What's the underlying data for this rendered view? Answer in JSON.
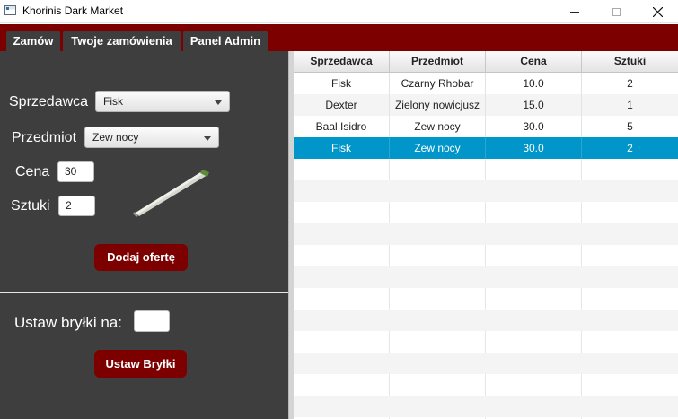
{
  "window": {
    "title": "Khorinis Dark Market"
  },
  "tabs": [
    {
      "label": "Zamów"
    },
    {
      "label": "Twoje zamówienia"
    },
    {
      "label": "Panel Admin"
    }
  ],
  "form": {
    "seller_label": "Sprzedawca",
    "seller_value": "Fisk",
    "item_label": "Przedmiot",
    "item_value": "Zew nocy",
    "price_label": "Cena",
    "price_value": "30",
    "quantity_label": "Sztuki",
    "quantity_value": "2",
    "add_button": "Dodaj ofertę",
    "nuggets_label": "Ustaw bryłki na:",
    "nuggets_value": "",
    "set_button": "Ustaw Bryłki"
  },
  "table": {
    "columns": [
      "Sprzedawca",
      "Przedmiot",
      "Cena",
      "Sztuki"
    ],
    "rows": [
      [
        "Fisk",
        "Czarny Rhobar",
        "10.0",
        "2"
      ],
      [
        "Dexter",
        "Zielony nowicjusz",
        "15.0",
        "1"
      ],
      [
        "Baal Isidro",
        "Zew nocy",
        "30.0",
        "5"
      ],
      [
        "Fisk",
        "Zew nocy",
        "30.0",
        "2"
      ]
    ],
    "selected_row": 3
  },
  "colors": {
    "accent": "#7c0000",
    "panel": "#3e3e3e",
    "selection": "#0096c9"
  }
}
